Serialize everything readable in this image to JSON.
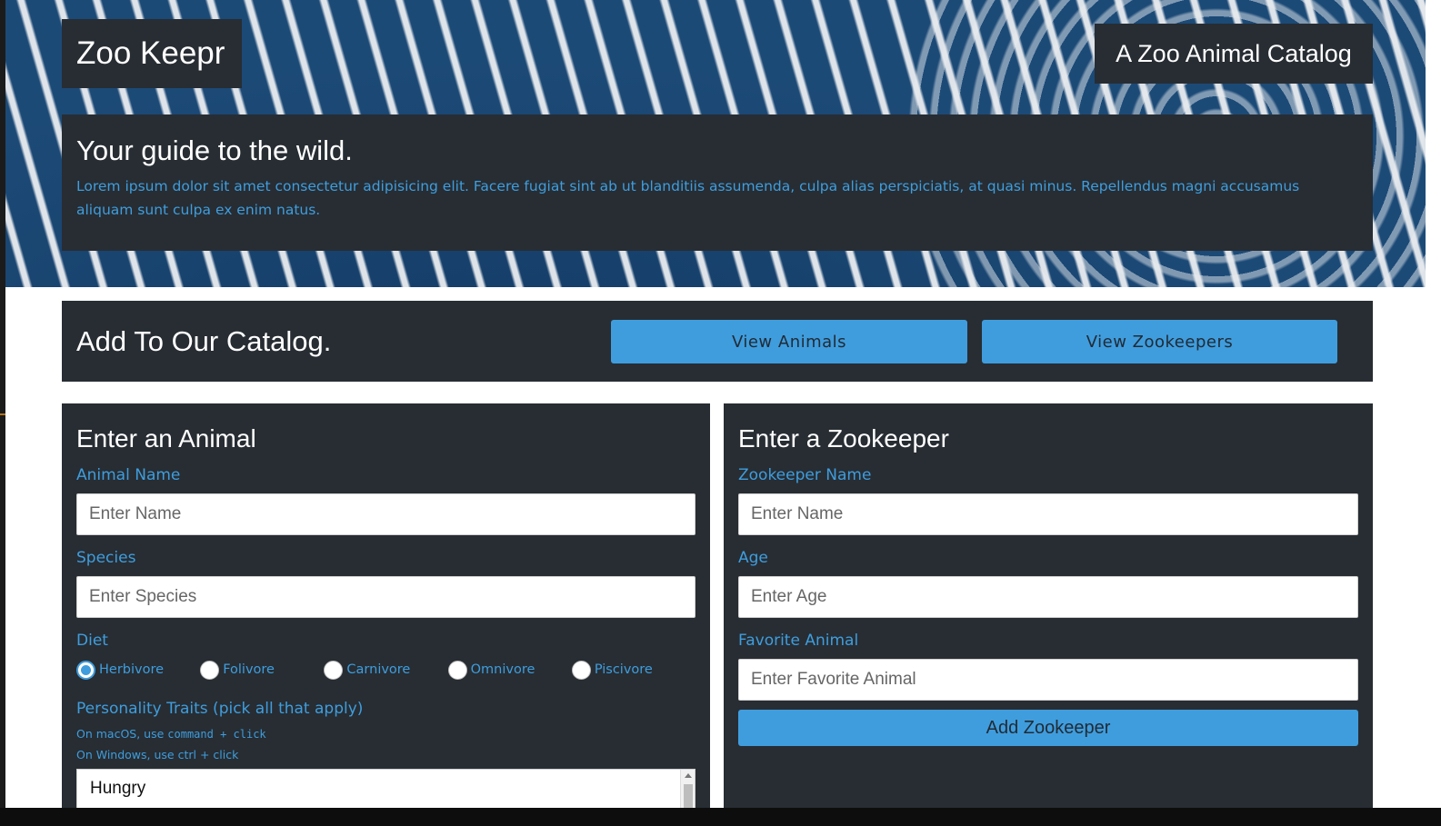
{
  "header": {
    "brand": "Zoo Keepr",
    "tagline": "A Zoo Animal Catalog"
  },
  "intro": {
    "title": "Your guide to the wild.",
    "text": "Lorem ipsum dolor sit amet consectetur adipisicing elit. Facere fugiat sint ab ut blanditiis assumenda, culpa alias perspiciatis, at quasi minus. Repellendus magni accusamus aliquam sunt culpa ex enim natus."
  },
  "catalog": {
    "title": "Add To Our Catalog.",
    "view_animals": "View Animals",
    "view_zookeepers": "View Zookeepers"
  },
  "animal_form": {
    "title": "Enter an Animal",
    "name_label": "Animal Name",
    "name_placeholder": "Enter Name",
    "species_label": "Species",
    "species_placeholder": "Enter Species",
    "diet_label": "Diet",
    "diet_options": [
      "Herbivore",
      "Folivore",
      "Carnivore",
      "Omnivore",
      "Piscivore"
    ],
    "diet_selected": "Herbivore",
    "traits_label": "Personality Traits (pick all that apply)",
    "hint_mac_prefix": "On macOS, use",
    "hint_mac_keys": "command + click",
    "hint_windows": "On Windows, use ctrl + click",
    "traits_options": [
      "Hungry"
    ]
  },
  "zookeeper_form": {
    "title": "Enter a Zookeeper",
    "name_label": "Zookeeper Name",
    "name_placeholder": "Enter Name",
    "age_label": "Age",
    "age_placeholder": "Enter Age",
    "favorite_label": "Favorite Animal",
    "favorite_placeholder": "Enter Favorite Animal",
    "submit": "Add Zookeeper"
  },
  "colors": {
    "panel": "#272d33",
    "accent": "#3f9ddd",
    "hero": "#1c4a77"
  }
}
